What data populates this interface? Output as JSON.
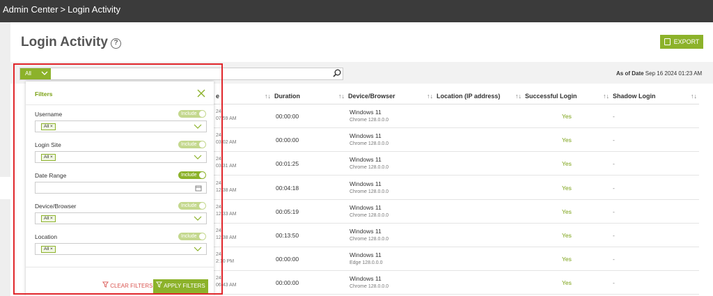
{
  "breadcrumb": {
    "root": "Admin Center",
    "separator": ">",
    "current": "Login Activity"
  },
  "page": {
    "title": "Login Activity",
    "help_icon": "question-circle-icon"
  },
  "toolbar": {
    "export_label": "EXPORT",
    "export_icon": "export-file-icon"
  },
  "search": {
    "filter_value": "All",
    "placeholder": "",
    "as_of_label": "As of Date",
    "as_of_value": "Sep 16 2024 01:23 AM"
  },
  "table": {
    "columns": [
      "e",
      "Duration",
      "Device/Browser",
      "Location (IP address)",
      "Successful Login",
      "Shadow Login"
    ],
    "sort_icon": "↑↓",
    "rows": [
      {
        "date": "24",
        "time": "07:59 AM",
        "duration": "00:00:00",
        "device": "Windows 11",
        "browser": "Chrome 128.0.0.0",
        "success": "Yes",
        "shadow": "-"
      },
      {
        "date": "24",
        "time": "03:02 AM",
        "duration": "00:00:00",
        "device": "Windows 11",
        "browser": "Chrome 128.0.0.0",
        "success": "Yes",
        "shadow": "-"
      },
      {
        "date": "24",
        "time": "03:31 AM",
        "duration": "00:01:25",
        "device": "Windows 11",
        "browser": "Chrome 128.0.0.0",
        "success": "Yes",
        "shadow": "-"
      },
      {
        "date": "24",
        "time": "12:38 AM",
        "duration": "00:04:18",
        "device": "Windows 11",
        "browser": "Chrome 128.0.0.0",
        "success": "Yes",
        "shadow": "-"
      },
      {
        "date": "24",
        "time": "12:33 AM",
        "duration": "00:05:19",
        "device": "Windows 11",
        "browser": "Chrome 128.0.0.0",
        "success": "Yes",
        "shadow": "-"
      },
      {
        "date": "24",
        "time": "12:38 AM",
        "duration": "00:13:50",
        "device": "Windows 11",
        "browser": "Chrome 128.0.0.0",
        "success": "Yes",
        "shadow": "-"
      },
      {
        "date": "24",
        "time": "2:10 PM",
        "duration": "00:00:00",
        "device": "Windows 11",
        "browser": "Edge 128.0.0.0",
        "success": "Yes",
        "shadow": "-"
      },
      {
        "date": "24",
        "time": "06:43 AM",
        "duration": "00:00:00",
        "device": "Windows 11",
        "browser": "Chrome 128.0.0.0",
        "success": "Yes",
        "shadow": "-"
      }
    ]
  },
  "filters": {
    "title": "Filters",
    "include_label": "Include",
    "items": [
      {
        "label": "Username",
        "chip": "All ×",
        "include": true
      },
      {
        "label": "Login Site",
        "chip": "All ×",
        "include": true
      },
      {
        "label": "Date Range",
        "chip": "",
        "include": true
      },
      {
        "label": "Device/Browser",
        "chip": "All ×",
        "include": true
      },
      {
        "label": "Location",
        "chip": "All ×",
        "include": true
      }
    ],
    "clear_label": "CLEAR FILTERS",
    "apply_label": "APPLY FILTERS"
  },
  "colors": {
    "accent": "#8cb22a",
    "highlight": "#e0262b",
    "topbar": "#3b3b3b"
  }
}
